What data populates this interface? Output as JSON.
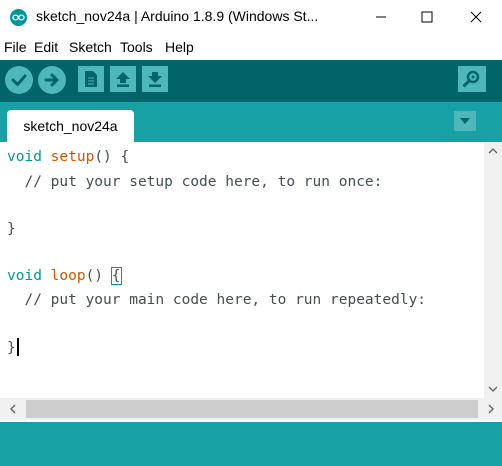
{
  "window": {
    "title": "sketch_nov24a | Arduino 1.8.9 (Windows St...",
    "icon": "arduino-logo-icon"
  },
  "menu": {
    "items": [
      {
        "label": "File"
      },
      {
        "label": "Edit"
      },
      {
        "label": "Sketch"
      },
      {
        "label": "Tools"
      },
      {
        "label": "Help"
      }
    ]
  },
  "toolbar": {
    "buttons": [
      "verify-icon",
      "upload-icon",
      "new-icon",
      "open-icon",
      "save-icon"
    ],
    "right_button": "serial-monitor-icon"
  },
  "tabs": [
    {
      "label": "sketch_nov24a"
    }
  ],
  "editor": {
    "lines": [
      {
        "type_kw": "void",
        "func": "setup",
        "rest": "() {"
      },
      {
        "comment": "  // put your setup code here, to run once:"
      },
      {
        "text": ""
      },
      {
        "text": "}"
      },
      {
        "text": ""
      },
      {
        "type_kw": "void",
        "func": "loop",
        "rest": "() ",
        "brace": "{"
      },
      {
        "comment": "  // put your main code here, to run repeatedly:"
      },
      {
        "text": ""
      },
      {
        "text": "}"
      }
    ]
  },
  "colors": {
    "toolbar": "#006468",
    "tabstrip": "#17a1a5",
    "button": "#4db7bb",
    "keyword": "#00979c",
    "function": "#d35400"
  }
}
